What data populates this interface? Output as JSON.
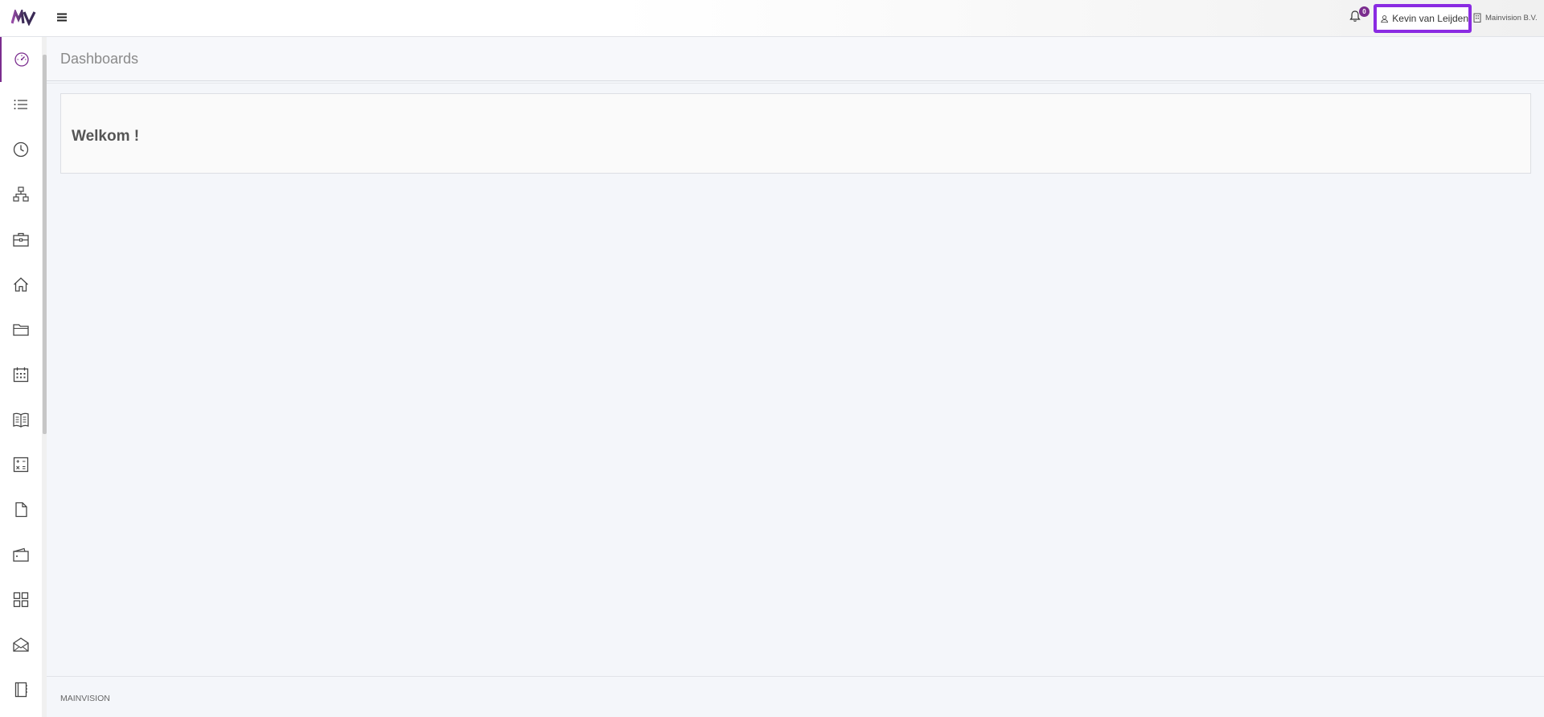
{
  "app": {
    "logo_text": "MV",
    "accent_color": "#7b2d8e",
    "highlight_color": "#8a2be2"
  },
  "topbar": {
    "notifications_count": "0",
    "user_name": "Kevin van Leijden",
    "company_name": "Mainvision B.V."
  },
  "sidebar": {
    "items": [
      {
        "icon": "dashboard-gauge-icon",
        "active": true
      },
      {
        "icon": "list-icon"
      },
      {
        "icon": "clock-icon"
      },
      {
        "icon": "hierarchy-icon"
      },
      {
        "icon": "briefcase-icon"
      },
      {
        "icon": "home-icon"
      },
      {
        "icon": "folder-icon"
      },
      {
        "icon": "calendar-icon"
      },
      {
        "icon": "book-icon"
      },
      {
        "icon": "calculator-icon"
      },
      {
        "icon": "document-icon"
      },
      {
        "icon": "wallet-icon"
      },
      {
        "icon": "grid-icon"
      },
      {
        "icon": "mail-open-icon"
      },
      {
        "icon": "notebook-icon"
      }
    ]
  },
  "main": {
    "page_title": "Dashboards",
    "welcome_text": "Welkom !"
  },
  "footer": {
    "text": "MAINVISION"
  }
}
